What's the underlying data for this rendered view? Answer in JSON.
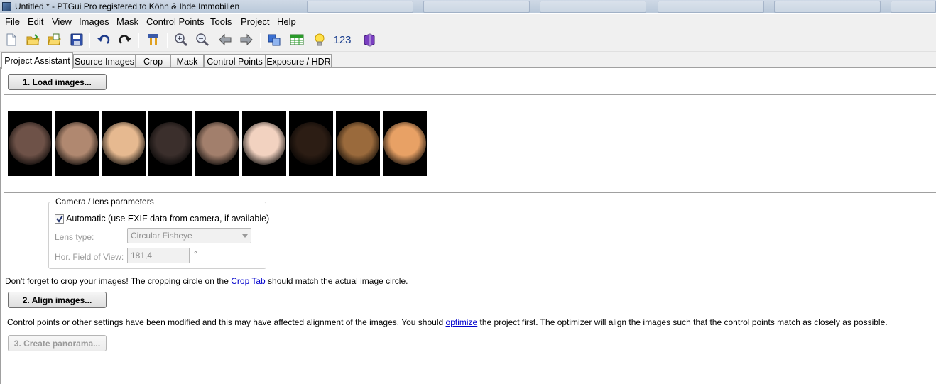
{
  "window": {
    "title": "Untitled * - PTGui Pro registered to Köhn & Ihde Immobilien"
  },
  "menu": [
    "File",
    "Edit",
    "View",
    "Images",
    "Mask",
    "Control Points",
    "Tools",
    "Project",
    "Help"
  ],
  "toolbar": {
    "icons": [
      "new-icon",
      "open-icon",
      "open-template-icon",
      "save-icon",
      "undo-icon",
      "redo-icon",
      "align-tools-icon",
      "zoom-in-icon",
      "zoom-out-icon",
      "back-arrow-icon",
      "forward-arrow-icon",
      "panorama-editor-icon",
      "control-point-table-icon",
      "lightbulb-icon",
      "numbers-icon",
      "book-icon"
    ],
    "numbers_label": "123"
  },
  "tabs": [
    {
      "label": "Project Assistant",
      "active": true
    },
    {
      "label": "Source Images",
      "active": false
    },
    {
      "label": "Crop",
      "active": false
    },
    {
      "label": "Mask",
      "active": false
    },
    {
      "label": "Control Points",
      "active": false
    },
    {
      "label": "Exposure / HDR",
      "active": false
    }
  ],
  "assistant": {
    "load_button": "1. Load images...",
    "align_button": "2. Align images...",
    "create_button": "3. Create panorama...",
    "thumbnails": [
      {
        "tone": "#6e5248"
      },
      {
        "tone": "#b08870"
      },
      {
        "tone": "#e6b990"
      },
      {
        "tone": "#3b2f2c"
      },
      {
        "tone": "#a27f6c"
      },
      {
        "tone": "#f2d2c0"
      },
      {
        "tone": "#2c1d14"
      },
      {
        "tone": "#9a6a3c"
      },
      {
        "tone": "#e8a165"
      }
    ],
    "camera": {
      "legend": "Camera / lens parameters",
      "automatic_label": "Automatic (use EXIF data from camera, if available)",
      "automatic_checked": true,
      "lens_type_label": "Lens type:",
      "lens_type_value": "Circular Fisheye",
      "hfov_label": "Hor. Field of View:",
      "hfov_value": "181,4",
      "hfov_unit": "°"
    },
    "crop_msg": {
      "before": "Don't forget to crop your images! The cropping circle on the ",
      "link": "Crop Tab",
      "after": " should match the actual image circle."
    },
    "optimize_msg": {
      "before": "Control points or other settings have been modified and this may have affected alignment of the images. You should ",
      "link": "optimize",
      "after": " the project first. The optimizer will align the images such that the control points match as closely as possible."
    }
  },
  "colors": {
    "link": "#0000cc",
    "disabled_text": "#9a9a9a"
  }
}
